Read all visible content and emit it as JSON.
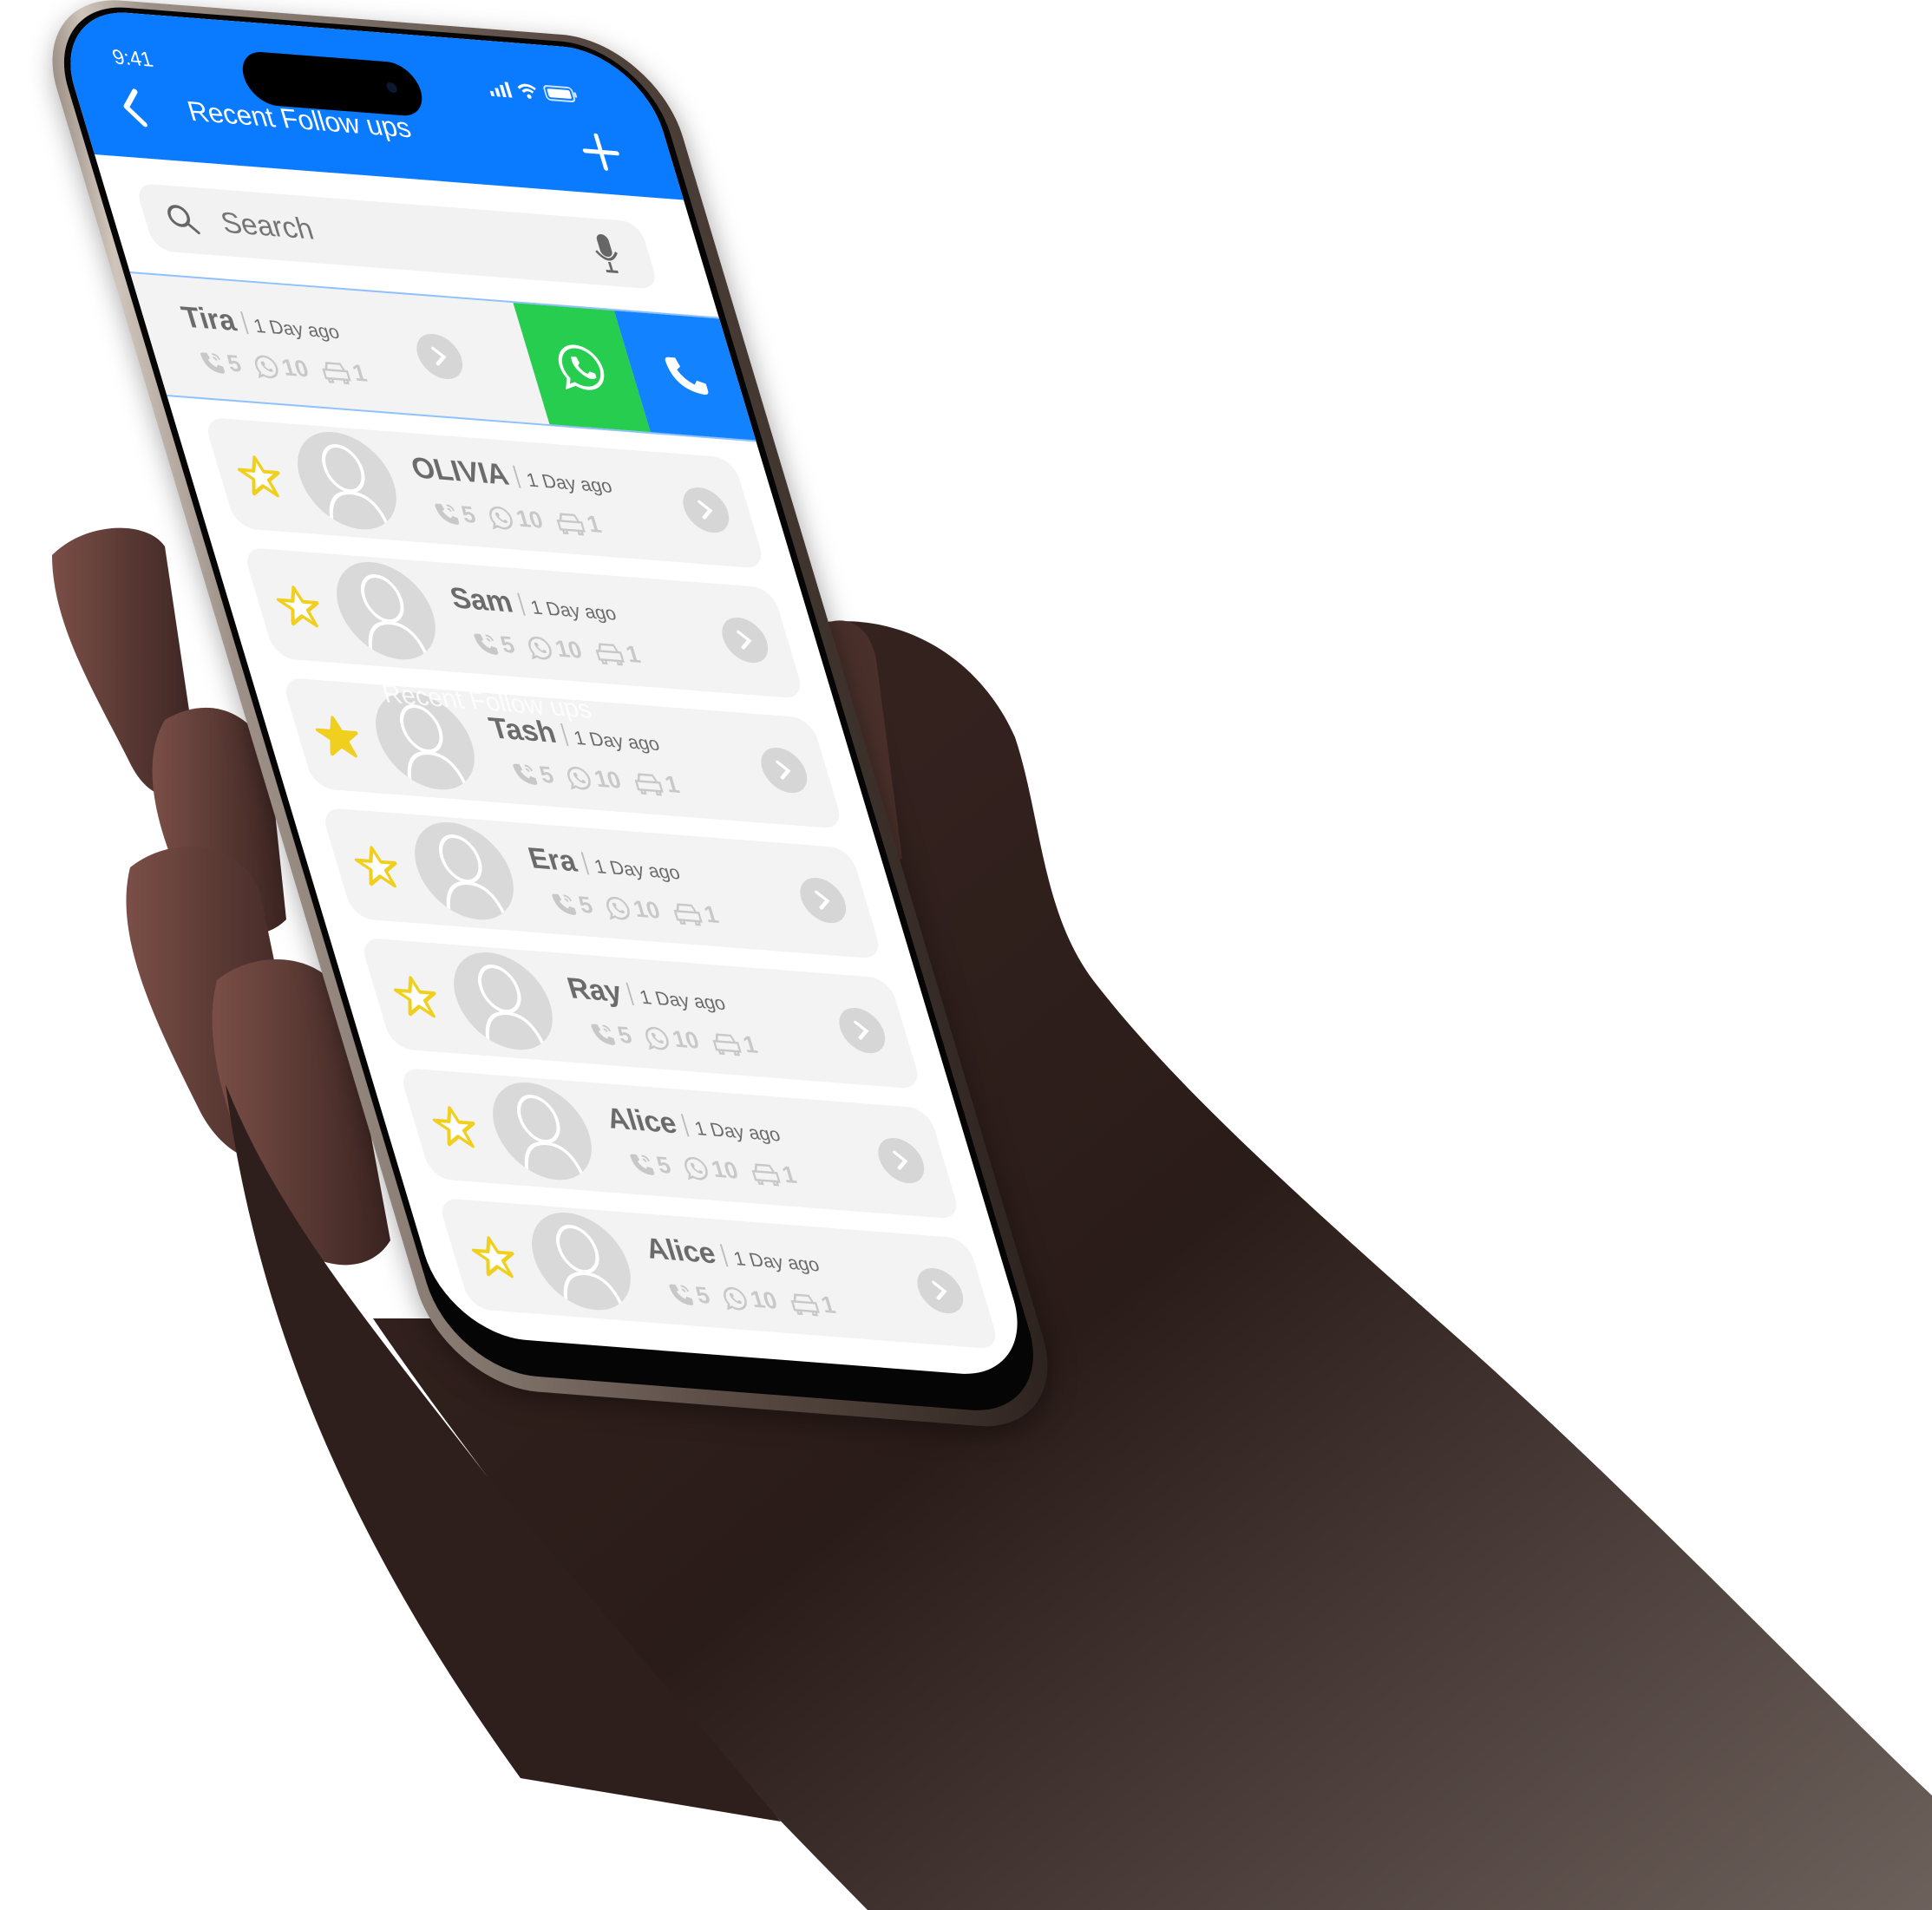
{
  "status_bar": {
    "time": "9:41"
  },
  "header": {
    "title": "Recent Follow ups",
    "back_icon": "chevron-left-icon",
    "add_icon": "plus-icon"
  },
  "search": {
    "placeholder": "Search",
    "value": "",
    "icon": "search-icon",
    "mic_icon": "microphone-icon"
  },
  "swiped_item": {
    "name": "Tira",
    "time_ago": "1 Day ago",
    "calls": "5",
    "whatsapp": "10",
    "visits": "1",
    "actions": [
      {
        "name": "whatsapp",
        "icon": "whatsapp-icon",
        "color": "#27cd4e"
      },
      {
        "name": "call",
        "icon": "phone-icon",
        "color": "#1282ff"
      }
    ]
  },
  "contacts": [
    {
      "name": "OLIVIA",
      "time_ago": "1 Day ago",
      "calls": "5",
      "whatsapp": "10",
      "visits": "1",
      "starred": false
    },
    {
      "name": "Sam",
      "time_ago": "1 Day ago",
      "calls": "5",
      "whatsapp": "10",
      "visits": "1",
      "starred": false
    },
    {
      "name": "Tash",
      "time_ago": "1 Day ago",
      "calls": "5",
      "whatsapp": "10",
      "visits": "1",
      "starred": true
    },
    {
      "name": "Era",
      "time_ago": "1 Day ago",
      "calls": "5",
      "whatsapp": "10",
      "visits": "1",
      "starred": false
    },
    {
      "name": "Ray",
      "time_ago": "1 Day ago",
      "calls": "5",
      "whatsapp": "10",
      "visits": "1",
      "starred": false
    },
    {
      "name": "Alice",
      "time_ago": "1 Day ago",
      "calls": "5",
      "whatsapp": "10",
      "visits": "1",
      "starred": false
    },
    {
      "name": "Alice",
      "time_ago": "1 Day ago",
      "calls": "5",
      "whatsapp": "10",
      "visits": "1",
      "starred": false
    }
  ],
  "ghost_overlay": {
    "title": "Recent Follow ups"
  },
  "colors": {
    "header_blue": "#0a7bff",
    "whatsapp_green": "#27cd4e",
    "call_blue": "#1282ff",
    "star_yellow": "#f0cf1e",
    "card_bg": "#f3f3f3"
  }
}
